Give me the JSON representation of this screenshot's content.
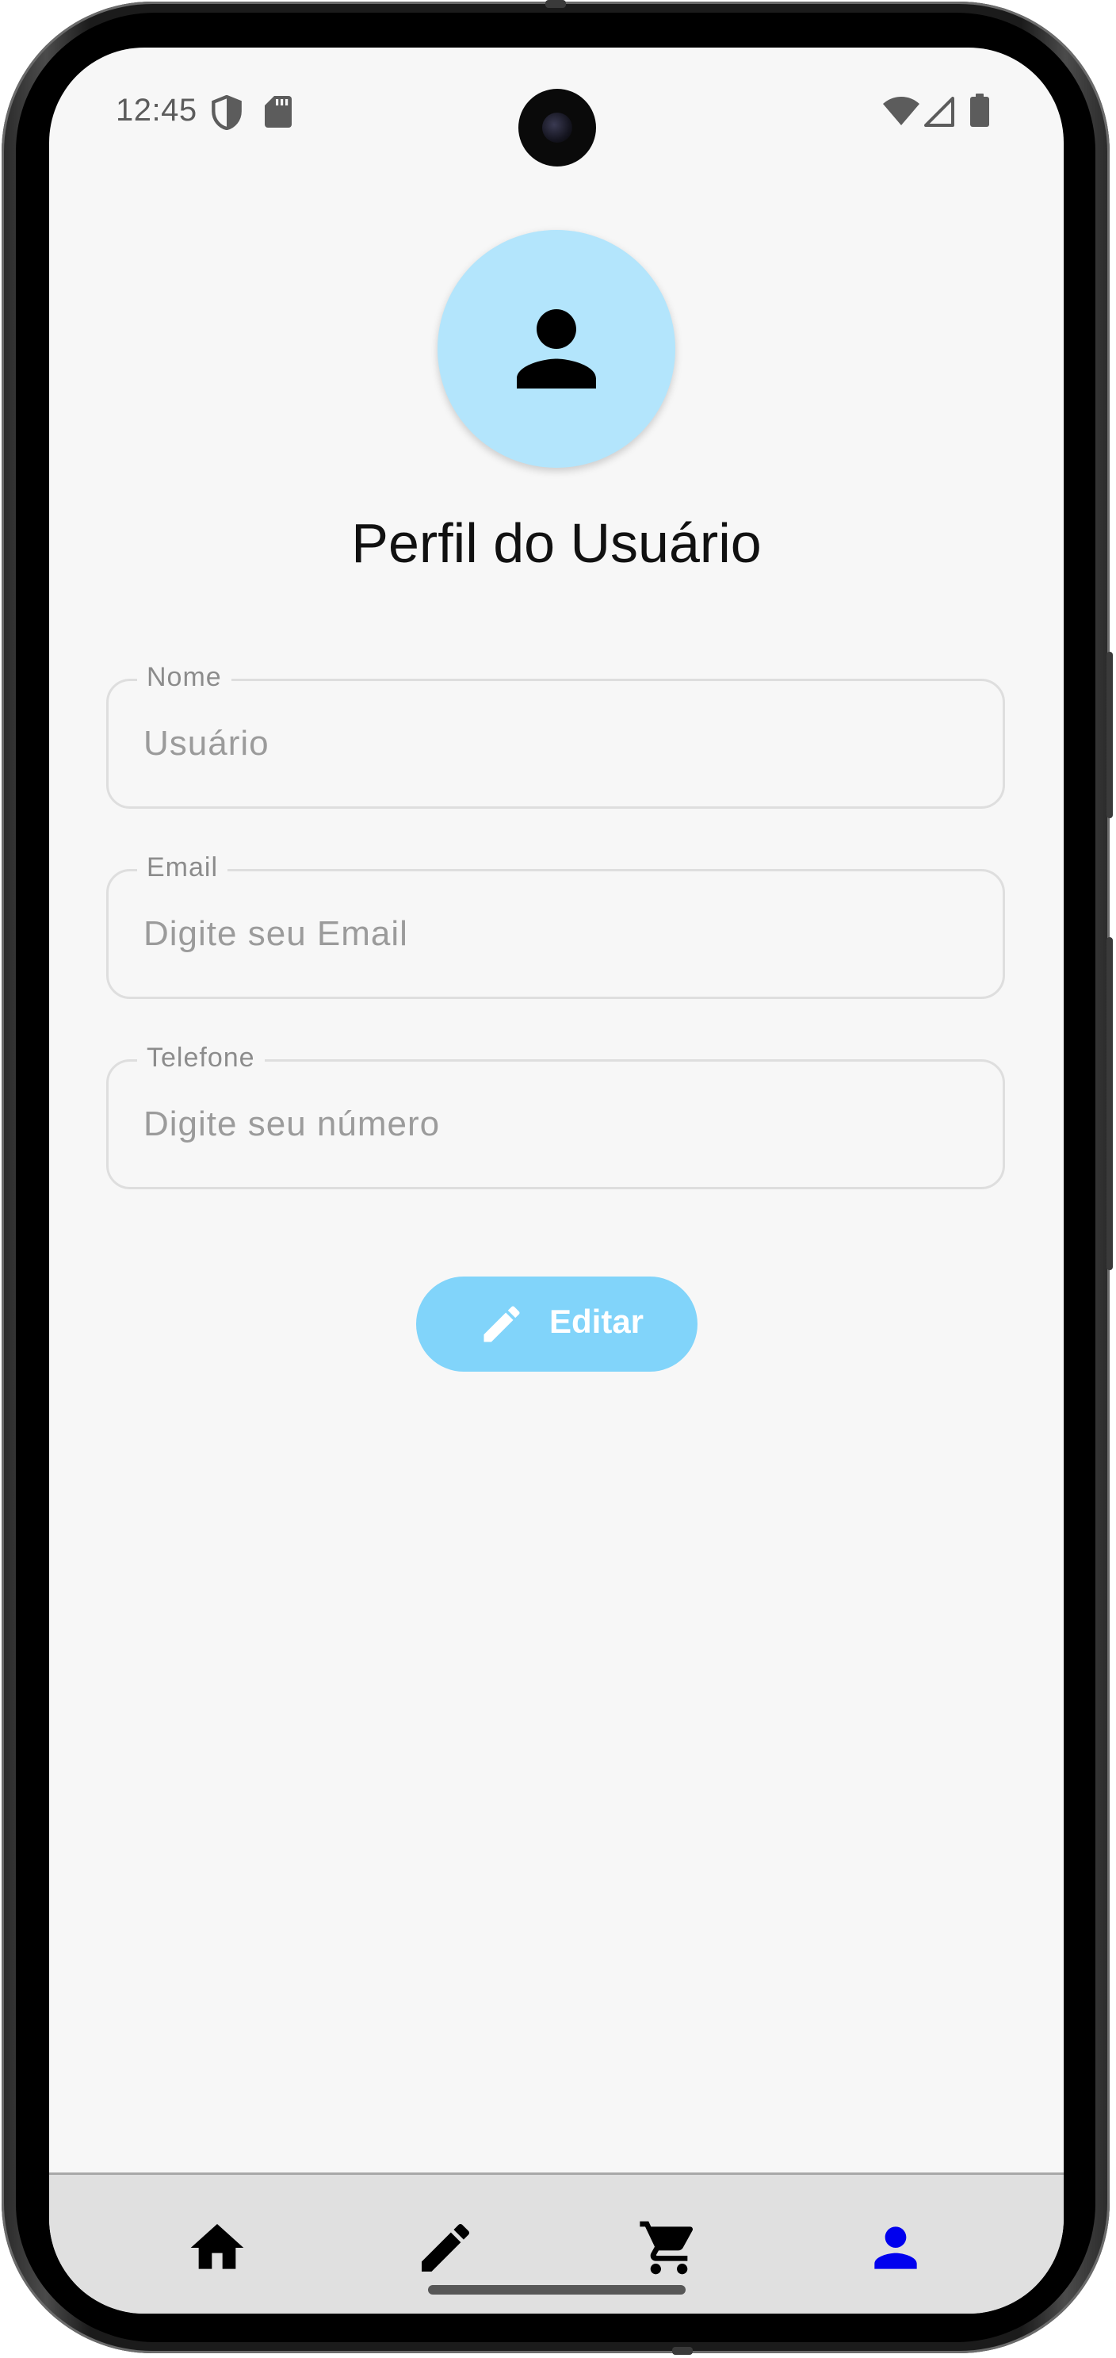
{
  "status_bar": {
    "time": "12:45",
    "left_icons": [
      "shield-icon",
      "sd-card-icon"
    ],
    "right_icons": [
      "wifi-icon",
      "cellular-signal-icon",
      "battery-icon"
    ]
  },
  "profile": {
    "avatar_icon": "person-icon",
    "avatar_color": "#b3e5fc",
    "title": "Perfil do Usuário"
  },
  "form": {
    "name": {
      "label": "Nome",
      "placeholder": "Usuário",
      "value": ""
    },
    "email": {
      "label": "Email",
      "placeholder": "Digite seu Email",
      "value": ""
    },
    "phone": {
      "label": "Telefone",
      "placeholder": "Digite seu número",
      "value": ""
    }
  },
  "edit_button": {
    "label": "Editar",
    "icon": "pencil-icon",
    "color": "#81d4fa"
  },
  "bottom_nav": {
    "items": [
      {
        "icon": "home-icon",
        "active": false
      },
      {
        "icon": "pencil-icon",
        "active": false
      },
      {
        "icon": "cart-icon",
        "active": false
      },
      {
        "icon": "person-icon",
        "active": true
      }
    ],
    "active_color": "#0000ee",
    "inactive_color": "#000000",
    "background": "#e0e0e0"
  }
}
